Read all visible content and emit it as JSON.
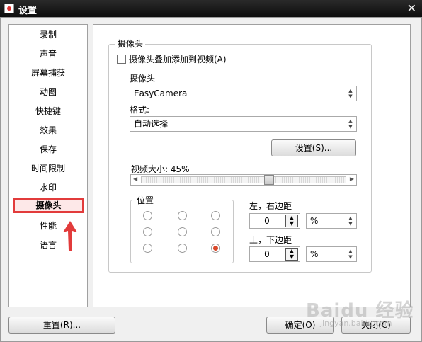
{
  "window": {
    "title": "设置"
  },
  "nav": {
    "items": [
      {
        "label": "录制"
      },
      {
        "label": "声音"
      },
      {
        "label": "屏幕捕获"
      },
      {
        "label": "动图"
      },
      {
        "label": "快捷键"
      },
      {
        "label": "效果"
      },
      {
        "label": "保存"
      },
      {
        "label": "时间限制"
      },
      {
        "label": "水印"
      },
      {
        "label": "摄像头",
        "selected": true
      },
      {
        "label": "性能"
      },
      {
        "label": "语言"
      }
    ]
  },
  "camera": {
    "group_title": "摄像头",
    "overlay_checkbox": {
      "label": "摄像头叠加添加到视频(A)",
      "checked": false
    },
    "device_label": "摄像头",
    "device_value": "EasyCamera",
    "format_label": "格式:",
    "format_value": "自动选择",
    "settings_button": "设置(S)...",
    "video_size_label": "视频大小: 45%",
    "video_size_fraction": 0.45,
    "position_title": "位置",
    "position_selected": "bottom-right",
    "lr_margin_label": "左，右边距",
    "lr_margin_value": "0",
    "lr_unit": "%",
    "tb_margin_label": "上，下边距",
    "tb_margin_value": "0",
    "tb_unit": "%"
  },
  "footer": {
    "reset_button": "重置(R)...",
    "ok_button": "确定(O)",
    "close_button": "关闭(C)"
  },
  "watermark": {
    "text": "Baidu 经验",
    "sub": "jingyan.baidu.com"
  },
  "colors": {
    "highlight": "#e23b3b",
    "radio_selected": "#d9482b"
  }
}
